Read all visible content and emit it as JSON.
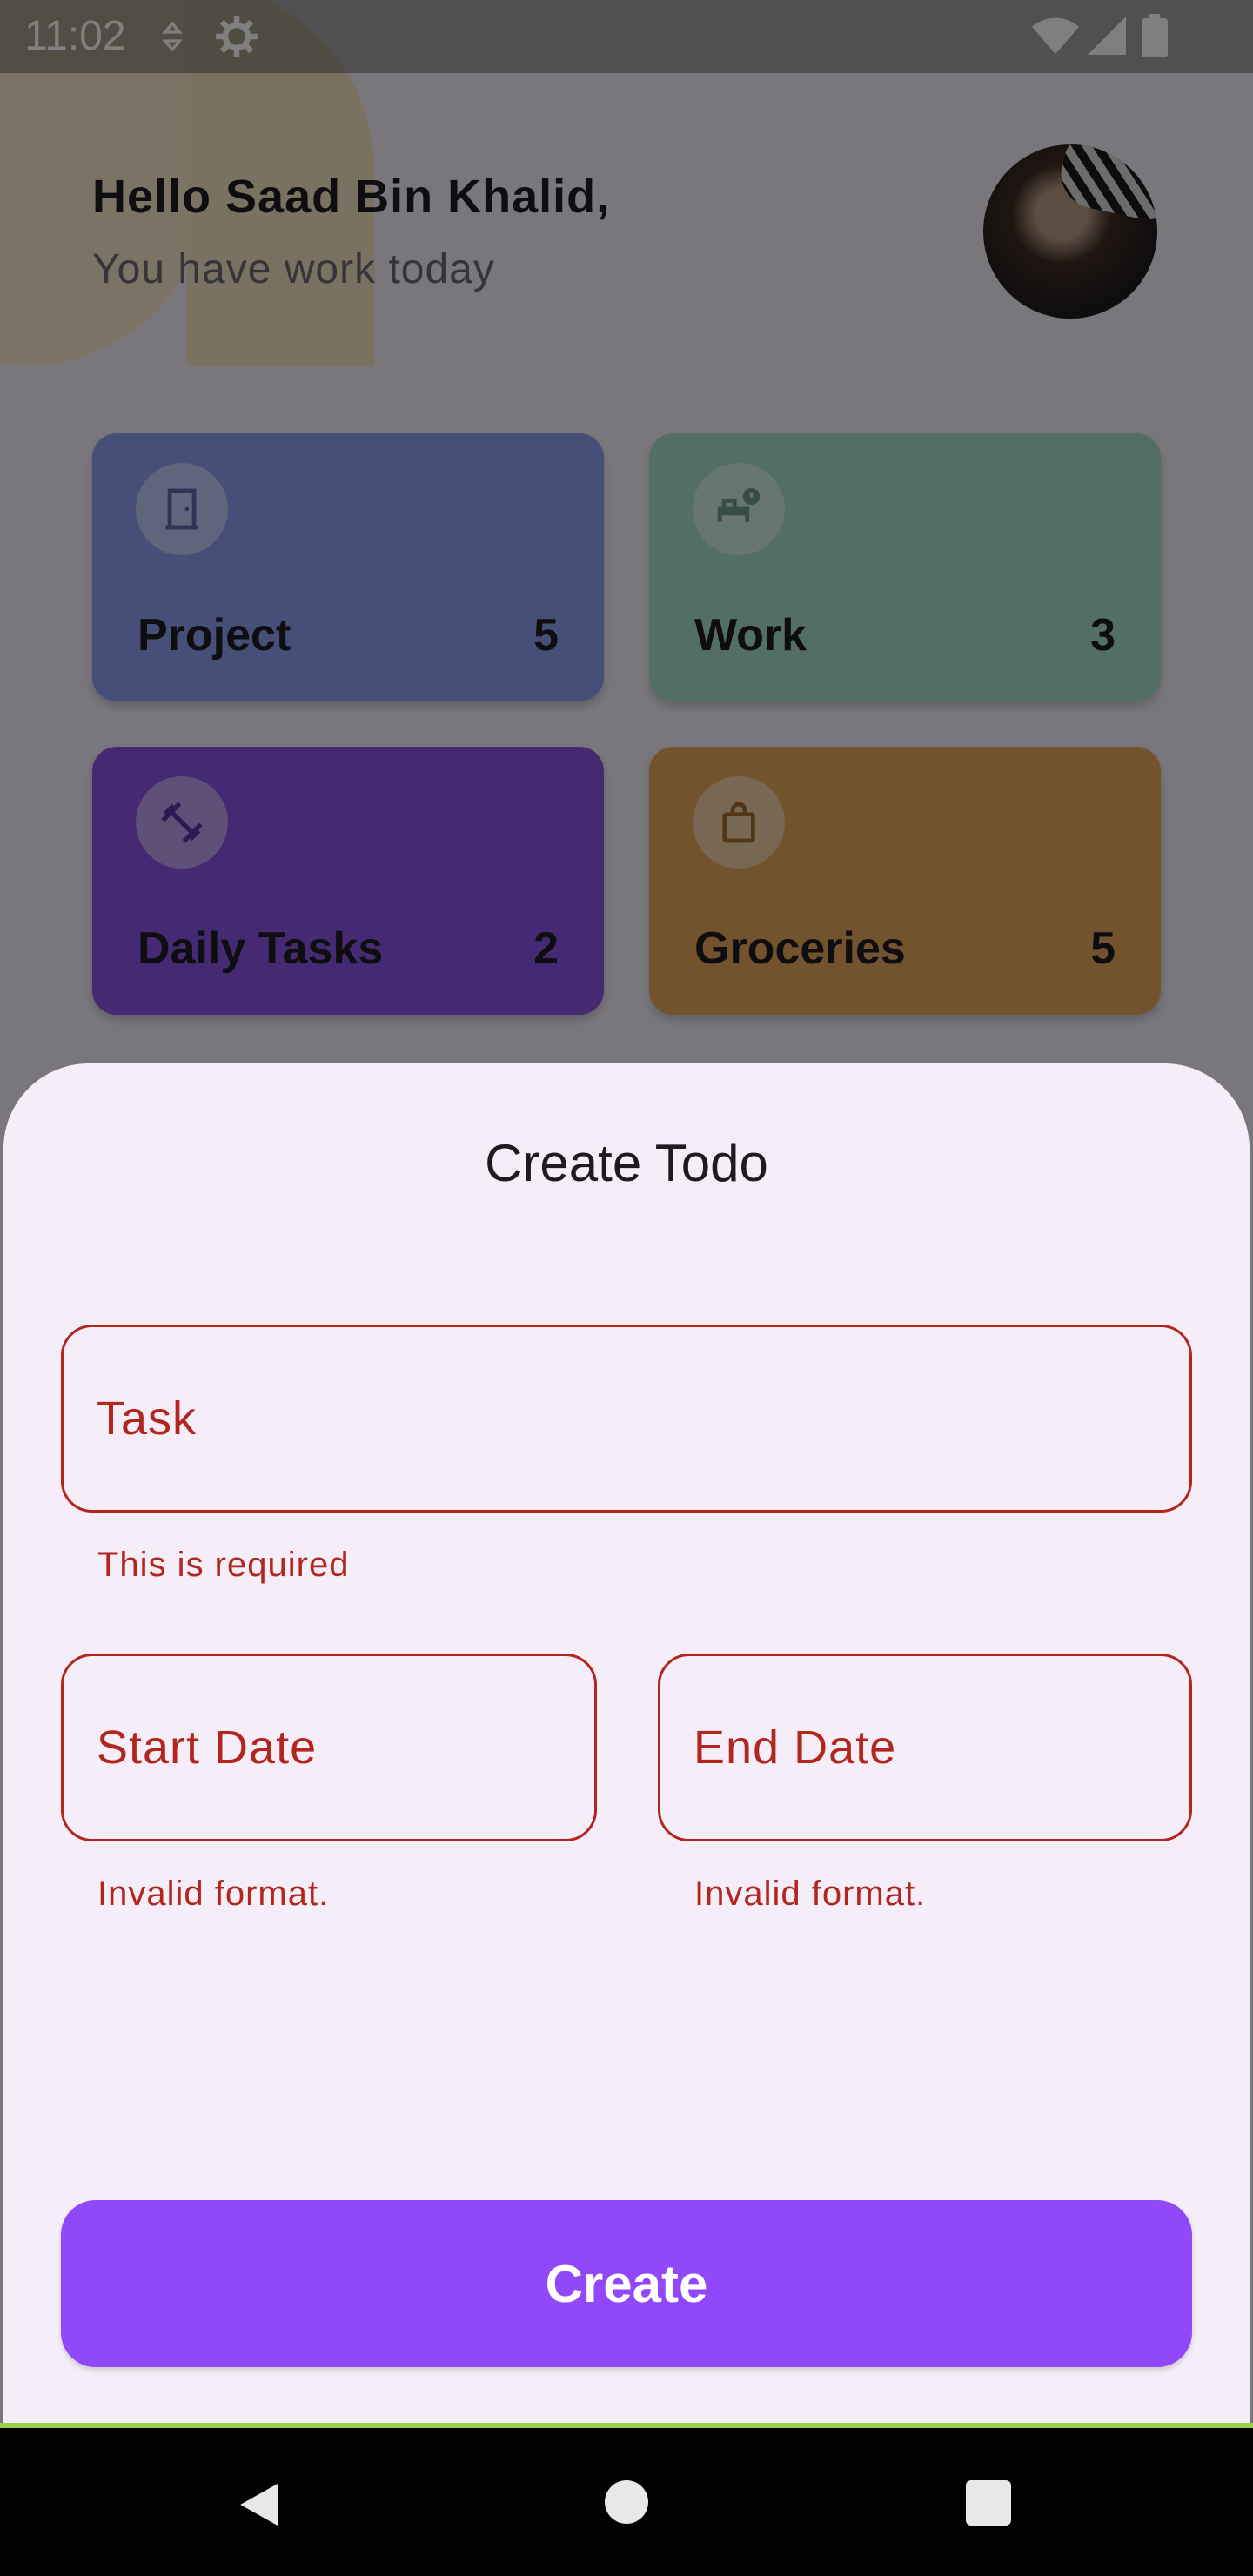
{
  "status_bar": {
    "time": "11:02",
    "icons": [
      "data-saver-icon",
      "settings-gear-icon",
      "wifi-icon",
      "signal-icon",
      "battery-icon"
    ]
  },
  "home": {
    "greeting": "Hello Saad Bin Khalid,",
    "subtitle": "You have work today",
    "avatar_icon": "profile-avatar",
    "categories": [
      {
        "label": "Project",
        "count": "5",
        "icon": "door-icon",
        "color": "#8b9fef"
      },
      {
        "label": "Work",
        "count": "3",
        "icon": "bed-alert-icon",
        "color": "#a6dec7"
      },
      {
        "label": "Daily Tasks",
        "count": "2",
        "icon": "dumbbell-icon",
        "color": "#8a55e6"
      },
      {
        "label": "Groceries",
        "count": "5",
        "icon": "shopping-bag-icon",
        "color": "#e6a65c"
      }
    ]
  },
  "sheet": {
    "title": "Create Todo",
    "task_placeholder": "Task",
    "task_error": "This is required",
    "start_placeholder": "Start Date",
    "start_error": "Invalid format.",
    "end_placeholder": "End Date",
    "end_error": "Invalid format.",
    "create_label": "Create"
  },
  "colors": {
    "error": "#b3261e",
    "primary": "#9147fa",
    "sheet_bg": "#f5eef8"
  },
  "nav_bar": {
    "icons": [
      "back-icon",
      "home-icon",
      "recents-icon"
    ]
  }
}
